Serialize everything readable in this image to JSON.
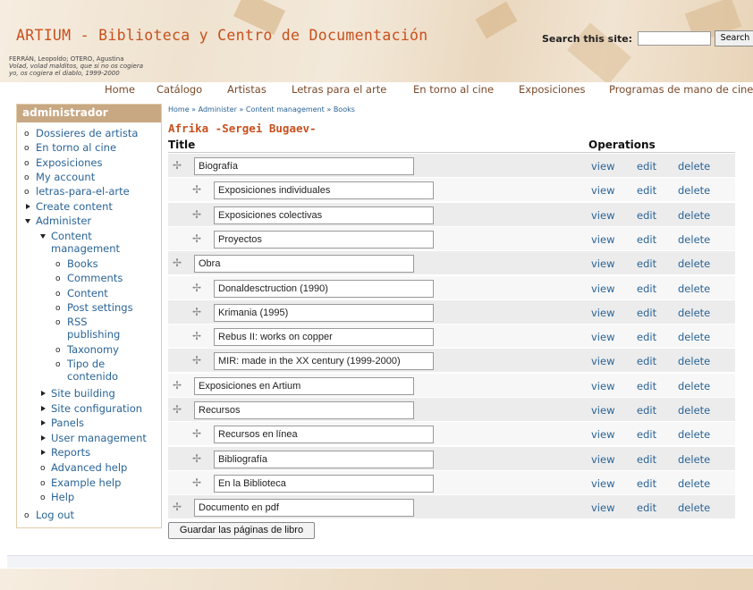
{
  "header": {
    "site_title": "ARTIUM - Biblioteca y Centro de Documentación",
    "quote_line1": "FERRÁN, Leopoldo; OTERO, Agustina",
    "quote_line2": "Volad, volad malditos, que si no os cogiera",
    "quote_line3": "yo, os cogiera el diablo, 1999-2000",
    "search_label": "Search this site:",
    "search_value": "",
    "search_button": "Search"
  },
  "nav": [
    "Home",
    "Catálogo",
    "Artistas",
    "Letras para el arte",
    "En torno al cine",
    "Exposiciones",
    "Programas de mano de cine"
  ],
  "sidebar": {
    "title": "administrador",
    "items": {
      "dossieres": "Dossieres de artista",
      "torno_cine": "En torno al cine",
      "exposiciones": "Exposiciones",
      "my_account": "My account",
      "letras": "letras-para-el-arte",
      "create_content": "Create content",
      "administer": "Administer",
      "content_mgmt_1": "Content",
      "content_mgmt_2": "management",
      "books": "Books",
      "comments": "Comments",
      "content": "Content",
      "post_settings": "Post settings",
      "rss_1": "RSS",
      "rss_2": "publishing",
      "taxonomy": "Taxonomy",
      "tipo_1": "Tipo de",
      "tipo_2": "contenido",
      "site_building": "Site building",
      "site_config": "Site configuration",
      "panels": "Panels",
      "user_mgmt": "User management",
      "reports": "Reports",
      "advanced_help": "Advanced help",
      "example_help": "Example help",
      "help": "Help",
      "log_out": "Log out"
    }
  },
  "breadcrumb": {
    "home": "Home",
    "administer": "Administer",
    "content_management": "Content management",
    "books": "Books",
    "sep": "»"
  },
  "page_title": "Afrika -Sergei Bugaev-",
  "table": {
    "col_title": "Title",
    "col_operations": "Operations",
    "drag_glyph": "✢",
    "op_view": "view",
    "op_edit": "edit",
    "op_delete": "delete",
    "rows": [
      {
        "title": "Biografía",
        "depth": 0
      },
      {
        "title": "Exposiciones individuales",
        "depth": 1
      },
      {
        "title": "Exposiciones colectivas",
        "depth": 1
      },
      {
        "title": "Proyectos",
        "depth": 1
      },
      {
        "title": "Obra",
        "depth": 0
      },
      {
        "title": "Donaldesctruction (1990)",
        "depth": 1
      },
      {
        "title": "Krimania (1995)",
        "depth": 1
      },
      {
        "title": "Rebus II: works on copper",
        "depth": 1
      },
      {
        "title": "MIR: made in the XX century (1999-2000)",
        "depth": 1
      },
      {
        "title": "Exposiciones en Artium",
        "depth": 0
      },
      {
        "title": "Recursos",
        "depth": 0
      },
      {
        "title": "Recursos en línea",
        "depth": 1
      },
      {
        "title": "Bibliografía",
        "depth": 1
      },
      {
        "title": "En la Biblioteca",
        "depth": 1
      },
      {
        "title": "Documento en pdf",
        "depth": 0
      }
    ]
  },
  "save_button": "Guardar las páginas de libro"
}
